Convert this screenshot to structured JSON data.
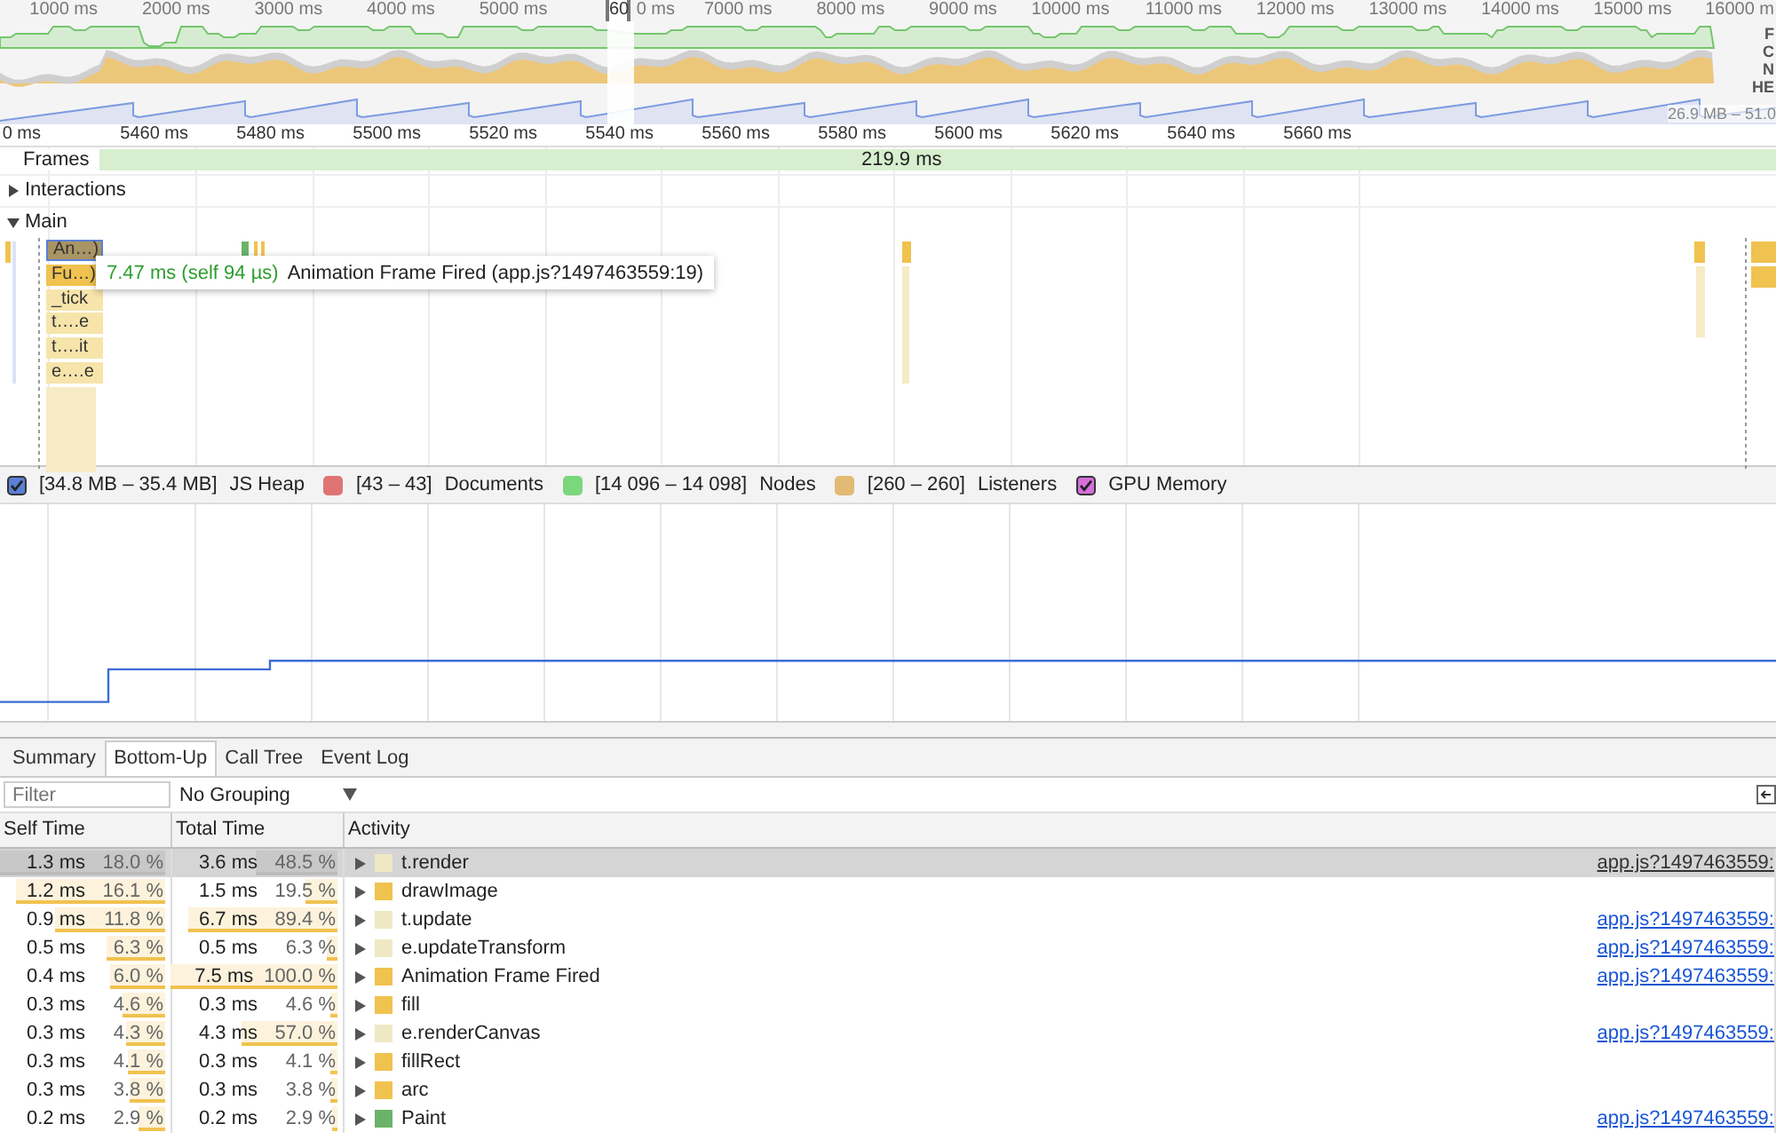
{
  "overview": {
    "ticks": [
      "1000 ms",
      "2000 ms",
      "3000 ms",
      "4000 ms",
      "5000 ms",
      "0 ms",
      "7000 ms",
      "8000 ms",
      "9000 ms",
      "10000 ms",
      "11000 ms",
      "12000 ms",
      "13000 ms",
      "14000 ms",
      "15000 ms",
      "16000 m"
    ],
    "handle_label": "60",
    "track_labels": [
      "F",
      "C",
      "N",
      "HE"
    ],
    "heap_range": "26.9 MB – 51.0"
  },
  "ruler": {
    "ticks": [
      "0 ms",
      "5460 ms",
      "5480 ms",
      "5500 ms",
      "5520 ms",
      "5540 ms",
      "5560 ms",
      "5580 ms",
      "5600 ms",
      "5620 ms",
      "5640 ms",
      "5660 ms"
    ]
  },
  "frames": {
    "label": "Frames",
    "duration": "219.9 ms"
  },
  "tracks": [
    {
      "label": "Interactions",
      "expanded": false
    },
    {
      "label": "Main",
      "expanded": true
    }
  ],
  "flame_blocks": [
    {
      "label": "An…)",
      "selected": true,
      "color": "#a89464"
    },
    {
      "label": "Fu…)",
      "selected": false,
      "color": "#f0c24f"
    },
    {
      "label": "_tick",
      "selected": false,
      "color": "#f6e4ab"
    },
    {
      "label": "t….e",
      "selected": false,
      "color": "#f6e4ab"
    },
    {
      "label": "t….it",
      "selected": false,
      "color": "#f6e4ab"
    },
    {
      "label": "e….e",
      "selected": false,
      "color": "#f6e4ab"
    }
  ],
  "tooltip": {
    "duration": "7.47 ms (self 94 µs)",
    "event": "Animation Frame Fired (app.js?1497463559:19)"
  },
  "counters": [
    {
      "reading": "[34.8 MB – 35.4 MB]",
      "label": "JS Heap",
      "checked": true,
      "color": "#5b7fd6"
    },
    {
      "reading": "[43 – 43]",
      "label": "Documents",
      "checked": false,
      "color": "#e07474"
    },
    {
      "reading": "[14 096 – 14 098]",
      "label": "Nodes",
      "checked": false,
      "color": "#7bd77b"
    },
    {
      "reading": "[260 – 260]",
      "label": "Listeners",
      "checked": false,
      "color": "#e2ba74"
    },
    {
      "label": "GPU Memory",
      "checked": true,
      "color": "#d56fdb"
    }
  ],
  "tabs": [
    {
      "label": "Summary",
      "selected": false
    },
    {
      "label": "Bottom-Up",
      "selected": true
    },
    {
      "label": "Call Tree",
      "selected": false
    },
    {
      "label": "Event Log",
      "selected": false
    }
  ],
  "filter": {
    "placeholder": "Filter"
  },
  "grouping": "No Grouping",
  "table": {
    "columns": [
      "Self Time",
      "Total Time",
      "Activity"
    ],
    "rows": [
      {
        "self_ms": "1.3 ms",
        "self_pct": "18.0 %",
        "self_bar": {
          "level": 1.0
        },
        "total_ms": "3.6 ms",
        "total_pct": "48.5 %",
        "total_bar": {
          "level": 0.485
        },
        "activity": "t.render",
        "color": "#efe8c4",
        "link": "app.js?1497463559:",
        "selected": true
      },
      {
        "self_ms": "1.2 ms",
        "self_pct": "16.1 %",
        "self_bar": {
          "level": 0.894
        },
        "total_ms": "1.5 ms",
        "total_pct": "19.5 %",
        "total_bar": {
          "level": 0.195
        },
        "activity": "drawImage",
        "color": "#f0c24f",
        "selected": false
      },
      {
        "self_ms": "0.9 ms",
        "self_pct": "11.8 %",
        "self_bar": {
          "level": 0.656
        },
        "total_ms": "6.7 ms",
        "total_pct": "89.4 %",
        "total_bar": {
          "level": 0.894
        },
        "activity": "t.update",
        "color": "#efe8c4",
        "link": "app.js?1497463559:",
        "selected": false
      },
      {
        "self_ms": "0.5 ms",
        "self_pct": "6.3 %",
        "self_bar": {
          "level": 0.35
        },
        "total_ms": "0.5 ms",
        "total_pct": "6.3 %",
        "total_bar": {
          "level": 0.063
        },
        "activity": "e.updateTransform",
        "color": "#efe8c4",
        "link": "app.js?1497463559:",
        "selected": false
      },
      {
        "self_ms": "0.4 ms",
        "self_pct": "6.0 %",
        "self_bar": {
          "level": 0.333
        },
        "total_ms": "7.5 ms",
        "total_pct": "100.0 %",
        "total_bar": {
          "level": 1.0
        },
        "activity": "Animation Frame Fired",
        "color": "#f0c24f",
        "link": "app.js?1497463559:",
        "selected": false
      },
      {
        "self_ms": "0.3 ms",
        "self_pct": "4.6 %",
        "self_bar": {
          "level": 0.256
        },
        "total_ms": "0.3 ms",
        "total_pct": "4.6 %",
        "total_bar": {
          "level": 0.046
        },
        "activity": "fill",
        "color": "#f0c24f",
        "selected": false
      },
      {
        "self_ms": "0.3 ms",
        "self_pct": "4.3 %",
        "self_bar": {
          "level": 0.239
        },
        "total_ms": "4.3 ms",
        "total_pct": "57.0 %",
        "total_bar": {
          "level": 0.57
        },
        "activity": "e.renderCanvas",
        "color": "#efe8c4",
        "link": "app.js?1497463559:",
        "selected": false
      },
      {
        "self_ms": "0.3 ms",
        "self_pct": "4.1 %",
        "self_bar": {
          "level": 0.228
        },
        "total_ms": "0.3 ms",
        "total_pct": "4.1 %",
        "total_bar": {
          "level": 0.041
        },
        "activity": "fillRect",
        "color": "#f0c24f",
        "selected": false
      },
      {
        "self_ms": "0.3 ms",
        "self_pct": "3.8 %",
        "self_bar": {
          "level": 0.211
        },
        "total_ms": "0.3 ms",
        "total_pct": "3.8 %",
        "total_bar": {
          "level": 0.038
        },
        "activity": "arc",
        "color": "#f0c24f",
        "selected": false
      },
      {
        "self_ms": "0.2 ms",
        "self_pct": "2.9 %",
        "self_bar": {
          "level": 0.161
        },
        "total_ms": "0.2 ms",
        "total_pct": "2.9 %",
        "total_bar": {
          "level": 0.029
        },
        "activity": "Paint",
        "color": "#6bb36b",
        "link": "app.js?1497463559:",
        "selected": false
      }
    ]
  }
}
